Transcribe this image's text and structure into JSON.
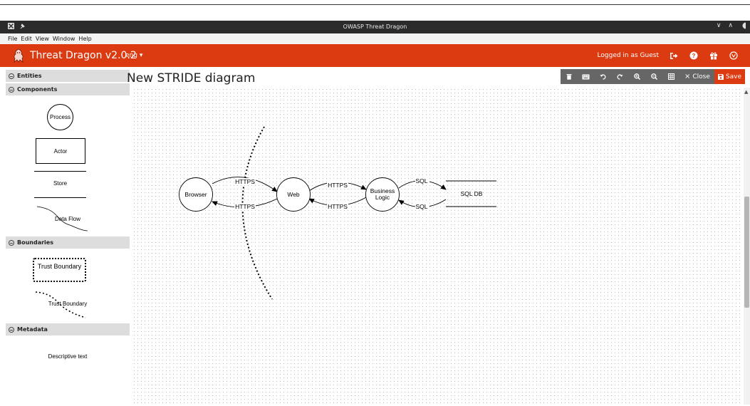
{
  "window": {
    "title": "OWASP Threat Dragon"
  },
  "menu": [
    "File",
    "Edit",
    "View",
    "Window",
    "Help"
  ],
  "navbar": {
    "brand": "Threat Dragon v2.0.2",
    "language": "eng ▾",
    "user": "Logged in as Guest",
    "accent": "#dc3a11"
  },
  "sidebar": {
    "sections": {
      "entities": "Entities",
      "components": "Components",
      "boundaries": "Boundaries",
      "metadata": "Metadata"
    },
    "stencils": {
      "process": "Process",
      "actor": "Actor",
      "store": "Store",
      "data_flow": "Data Flow",
      "trust_boundary_box": "Trust Boundary",
      "trust_boundary_curve": "Trust Boundary",
      "descriptive_text": "Descriptive text"
    }
  },
  "diagram": {
    "title": "New STRIDE diagram",
    "toolbar": {
      "close": "Close",
      "save": "Save"
    },
    "nodes": {
      "browser": "Browser",
      "web": "Web",
      "business_logic_line1": "Business",
      "business_logic_line2": "Logic",
      "sql_db": "SQL DB"
    },
    "flows": {
      "browser_to_web": "HTTPS",
      "web_to_browser": "HTTPS",
      "web_to_logic": "HTTPS",
      "logic_to_web": "HTTPS",
      "logic_to_db": "SQL",
      "db_to_logic": "SQL"
    }
  }
}
